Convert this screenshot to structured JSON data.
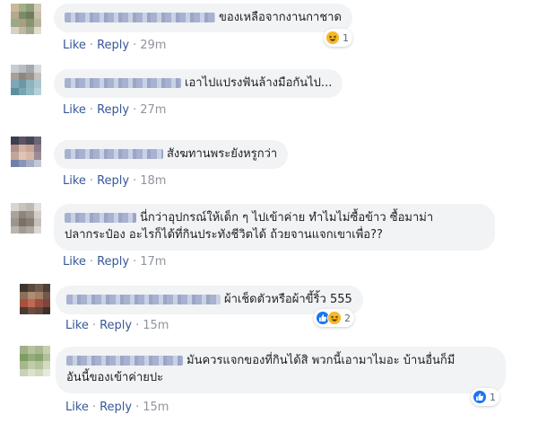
{
  "actions": {
    "like": "Like",
    "reply": "Reply",
    "separator": "·"
  },
  "colors": {
    "link": "#385898",
    "bubble": "#f2f3f5",
    "like_reaction": "#1877f2",
    "haha_reaction": "#f7b928"
  },
  "comments": [
    {
      "author": "",
      "text": "ของเหลือจากงานกาชาด",
      "time": "29m",
      "reactions": [
        "haha"
      ],
      "reaction_count": "1"
    },
    {
      "author": "",
      "text": "เอาไปแปรงฟันล้างมือกันไป...",
      "time": "27m",
      "reactions": [],
      "reaction_count": ""
    },
    {
      "author": "",
      "text": "สังฆทานพระยังหรูกว่า",
      "time": "18m",
      "reactions": [],
      "reaction_count": ""
    },
    {
      "author": "",
      "text_line1": "นี่กว่าอุปกรณ์ให้เด็ก ๆ ไปเข้าค่าย ทำไมไม่ซื้อข้าว ซื้อมาม่า",
      "text_line2": "ปลากระป๋อง อะไรก็ได้ที่กินประทังชีวิตได้ ถ้วยจานแจกเขาเพื่อ??",
      "time": "17m",
      "reactions": [],
      "reaction_count": ""
    },
    {
      "author": "",
      "text": "ผ้าเช็ดตัวหรือผ้าขี้ริ้ว 555",
      "time": "15m",
      "reactions": [
        "like",
        "haha"
      ],
      "reaction_count": "2"
    },
    {
      "author": "",
      "text_line1": "มันควรแจกของที่กินได้สิ พวกนี้เอามาไมอะ บ้านอื่นก็มี",
      "text_line2": "อันนี้ของเข้าค่ายปะ",
      "time": "15m",
      "reactions": [
        "like"
      ],
      "reaction_count": "1"
    }
  ]
}
